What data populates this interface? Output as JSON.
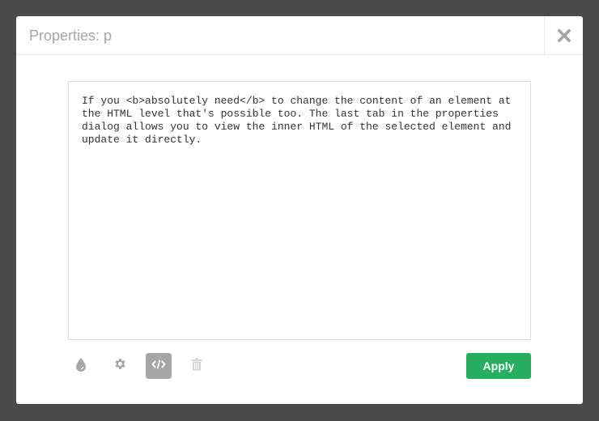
{
  "dialog": {
    "title": "Properties: p",
    "close_icon": "close-icon",
    "editor": {
      "content": "If you <b>absolutely need</b> to change the content of an element at the HTML level that's possible too. The last tab in the properties dialog allows you to view the inner HTML of the selected element and update it directly."
    },
    "toolbar": {
      "tabs": [
        {
          "icon": "droplet-icon",
          "label": "Styles",
          "active": false
        },
        {
          "icon": "gear-icon",
          "label": "Attributes",
          "active": false
        },
        {
          "icon": "code-icon",
          "label": "Inner HTML",
          "active": true
        },
        {
          "icon": "trash-icon",
          "label": "Delete",
          "enabled": false
        }
      ],
      "apply_label": "Apply"
    },
    "colors": {
      "apply": "#27ae60",
      "active_tab": "#a6a6a6",
      "icon": "#a6a6a6",
      "icon_disabled": "#d4d4d4",
      "backdrop": "#4a4a4a"
    }
  }
}
